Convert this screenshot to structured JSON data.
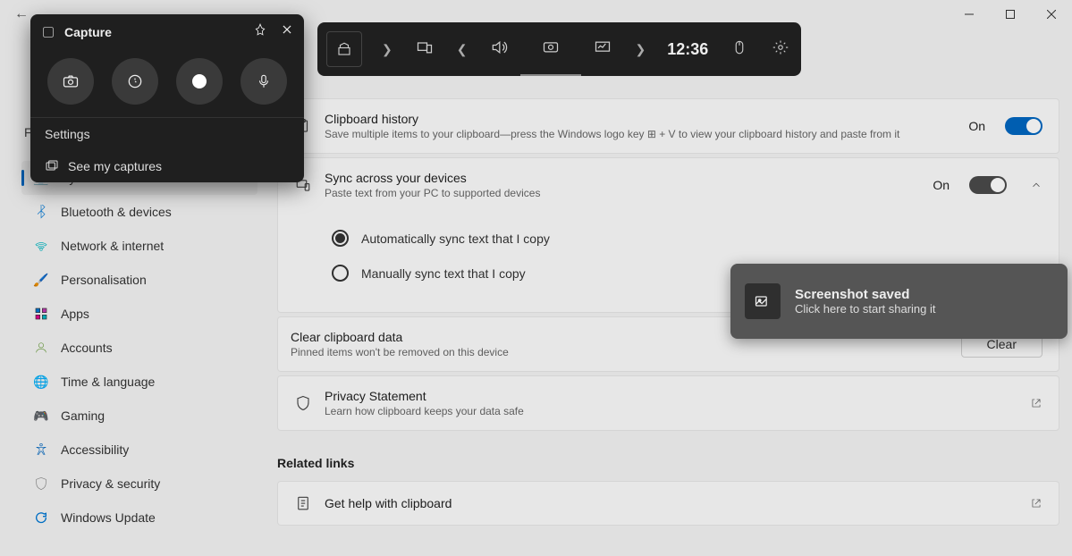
{
  "titlebar": {
    "back": "←"
  },
  "search": {
    "hint": "Fi"
  },
  "sidebar": {
    "items": [
      {
        "icon": "system",
        "label": "System",
        "selected": true
      },
      {
        "icon": "bluetooth",
        "label": "Bluetooth & devices"
      },
      {
        "icon": "network",
        "label": "Network & internet"
      },
      {
        "icon": "personalisation",
        "label": "Personalisation"
      },
      {
        "icon": "apps",
        "label": "Apps"
      },
      {
        "icon": "accounts",
        "label": "Accounts"
      },
      {
        "icon": "time",
        "label": "Time & language"
      },
      {
        "icon": "gaming",
        "label": "Gaming"
      },
      {
        "icon": "accessibility",
        "label": "Accessibility"
      },
      {
        "icon": "privacy",
        "label": "Privacy & security"
      },
      {
        "icon": "update",
        "label": "Windows Update"
      }
    ]
  },
  "settings": {
    "clipboard_history": {
      "title": "Clipboard history",
      "sub": "Save multiple items to your clipboard—press the Windows logo key ⊞ + V to view your clipboard history and paste from it",
      "state": "On"
    },
    "sync": {
      "title": "Sync across your devices",
      "sub": "Paste text from your PC to supported devices",
      "state": "On",
      "options": [
        {
          "label": "Automatically sync text that I copy",
          "checked": true
        },
        {
          "label": "Manually sync text that I copy",
          "checked": false
        }
      ]
    },
    "clear": {
      "title": "Clear clipboard data",
      "sub": "Pinned items won't be removed on this device",
      "button": "Clear"
    },
    "privacy": {
      "title": "Privacy Statement",
      "sub": "Learn how clipboard keeps your data safe"
    },
    "related": "Related links",
    "help": {
      "title": "Get help with clipboard"
    }
  },
  "capture": {
    "title": "Capture",
    "settings": "Settings",
    "see": "See my captures"
  },
  "gamebar": {
    "time": "12:36"
  },
  "toast": {
    "title": "Screenshot saved",
    "sub": "Click here to start sharing it"
  }
}
